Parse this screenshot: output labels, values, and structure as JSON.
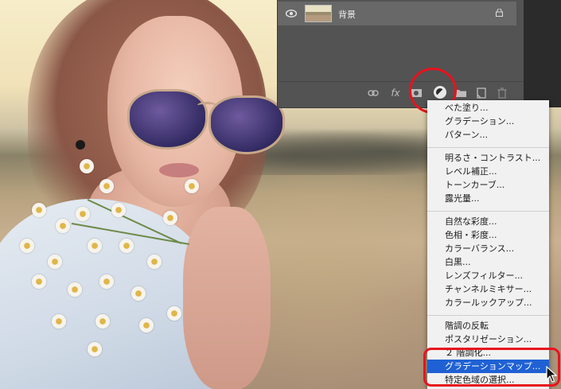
{
  "layers_panel": {
    "layer": {
      "name": "背景",
      "visible": true,
      "locked": true
    },
    "bottom_icons": [
      "link-icon",
      "fx-icon",
      "mask-icon",
      "adjustment-layer-icon",
      "folder-icon",
      "new-layer-icon",
      "trash-icon"
    ],
    "fx_label": "fx"
  },
  "adjustment_menu": {
    "groups": [
      {
        "items": [
          "べた塗り...",
          "グラデーション...",
          "パターン..."
        ]
      },
      {
        "items": [
          "明るさ・コントラスト...",
          "レベル補正...",
          "トーンカーブ...",
          "露光量..."
        ]
      },
      {
        "items": [
          "自然な彩度...",
          "色相・彩度...",
          "カラーバランス...",
          "白黒...",
          "レンズフィルター...",
          "チャンネルミキサー...",
          "カラールックアップ..."
        ]
      },
      {
        "items": [
          "階調の反転",
          "ポスタリゼーション...",
          "２ 階調化...",
          "グラデーションマップ...",
          "特定色域の選択..."
        ]
      }
    ],
    "highlighted": "グラデーションマップ..."
  },
  "colors": {
    "menu_highlight": "#1f61d4",
    "annotation": "#e8131d",
    "panel": "#535353"
  }
}
